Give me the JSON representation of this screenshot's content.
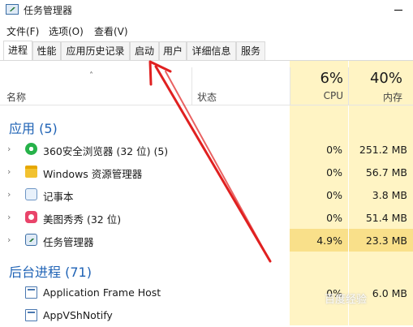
{
  "window": {
    "title": "任务管理器"
  },
  "menu": [
    "文件(F)",
    "选项(O)",
    "查看(V)"
  ],
  "tabs": [
    "进程",
    "性能",
    "应用历史记录",
    "启动",
    "用户",
    "详细信息",
    "服务"
  ],
  "active_tab": "进程",
  "columns": {
    "name": "名称",
    "status": "状态",
    "cpu_total": "6%",
    "cpu_label": "CPU",
    "mem_total": "40%",
    "mem_label": "内存"
  },
  "sections": {
    "apps": "应用 (5)",
    "background": "后台进程 (71)"
  },
  "apps": [
    {
      "name": "360安全浏览器 (32 位) (5)",
      "cpu": "0%",
      "mem": "251.2 MB",
      "icon": "browser-360-icon"
    },
    {
      "name": "Windows 资源管理器",
      "cpu": "0%",
      "mem": "56.7 MB",
      "icon": "folder-icon"
    },
    {
      "name": "记事本",
      "cpu": "0%",
      "mem": "3.8 MB",
      "icon": "notepad-icon"
    },
    {
      "name": "美图秀秀 (32 位)",
      "cpu": "0%",
      "mem": "51.4 MB",
      "icon": "meitu-icon"
    },
    {
      "name": "任务管理器",
      "cpu": "4.9%",
      "mem": "23.3 MB",
      "icon": "taskmgr-icon"
    }
  ],
  "background": [
    {
      "name": "Application Frame Host",
      "cpu": "0%",
      "mem": "6.0 MB",
      "icon": "window-icon"
    },
    {
      "name": "AppVShNotify",
      "cpu": "",
      "mem": "",
      "icon": "window-icon"
    }
  ],
  "watermark": "百度经验",
  "colors": {
    "accent": "#1e62b5",
    "arrow": "#e02020",
    "column_highlight": "#fff4c4",
    "cell_highlight": "#f9e08a"
  }
}
